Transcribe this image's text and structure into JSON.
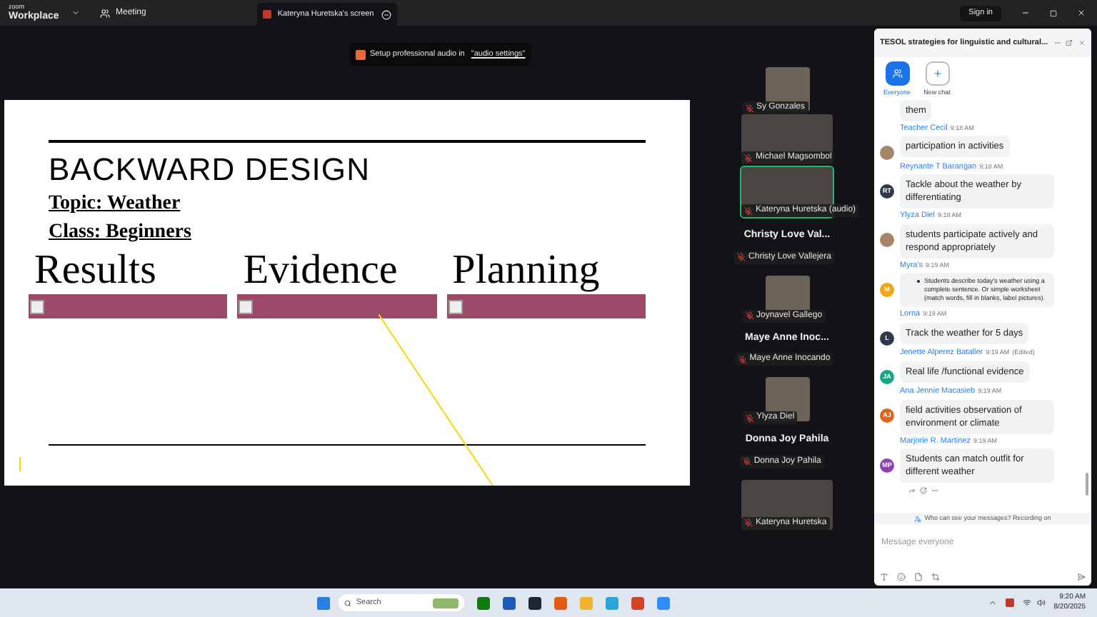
{
  "top_bar": {
    "brand_small": "zoom",
    "brand": "Workplace",
    "meeting_label": "Meeting",
    "screen_tab": "Kateryna Huretska's screen",
    "sign_in": "Sign in"
  },
  "notice": {
    "text": "Setup professional audio in ",
    "link": "\"audio settings\""
  },
  "slide": {
    "title": "BACKWARD DESIGN",
    "topic": "Topic: Weather",
    "class_line": "Class: Beginners",
    "columns": [
      "Results",
      "Evidence",
      "Planning"
    ]
  },
  "participants": [
    {
      "kind": "video_small",
      "name": "Sy Gonzales",
      "speaking": false
    },
    {
      "kind": "video_wide",
      "name": "Michael Magsombol",
      "speaking": false
    },
    {
      "kind": "video_wide",
      "name": "Kateryna Huretska (audio)",
      "speaking": true
    },
    {
      "kind": "name_tile",
      "heading": "Christy Love Val...",
      "name": "Christy Love Vallejera"
    },
    {
      "kind": "video_small",
      "name": "Joynavel Gallego",
      "speaking": false
    },
    {
      "kind": "name_tile",
      "heading": "Maye Anne Inoc...",
      "name": "Maye Anne Inocando"
    },
    {
      "kind": "video_small",
      "name": "Ylyza Diel",
      "speaking": false
    },
    {
      "kind": "name_tile",
      "heading": "Donna Joy Pahila",
      "name": "Donna Joy Pahila"
    },
    {
      "kind": "video_wide",
      "name": "Kateryna Huretska",
      "speaking": false
    }
  ],
  "chat": {
    "title": "TESOL strategies for linguistic and cultural...",
    "tabs": [
      {
        "label": "Everyone",
        "selected": true,
        "kind": "group"
      },
      {
        "label": "New chat",
        "selected": false,
        "kind": "new"
      }
    ],
    "messages": [
      {
        "kind": "text",
        "text": "them"
      },
      {
        "kind": "text",
        "sender": "Teacher Cecil",
        "time": "9:18 AM",
        "avatar": {
          "kind": "photo"
        },
        "text": "participation in activities"
      },
      {
        "kind": "text",
        "sender": "Reynante T Barangan",
        "time": "9:18 AM",
        "avatar": {
          "kind": "initials",
          "initials": "RT",
          "color": "#2f3b4c"
        },
        "text": "Tackle about the weather by differentiating"
      },
      {
        "kind": "text",
        "sender": "Ylyza Diel",
        "time": "9:18 AM",
        "avatar": {
          "kind": "photo"
        },
        "text": "students participate actively and respond appropriately"
      },
      {
        "kind": "bullet",
        "sender": "Myra's",
        "time": "9:19 AM",
        "avatar": {
          "kind": "initials",
          "initials": "M",
          "color": "#f2a516"
        },
        "text": "Students describe today's weather using a complete sentence. Or simple worksheet (match words, fill in blanks, label pictures)."
      },
      {
        "kind": "text",
        "sender": "Lorna",
        "time": "9:19 AM",
        "avatar": {
          "kind": "initials",
          "initials": "L",
          "color": "#2f3b4c"
        },
        "text": "Track the weather for 5 days"
      },
      {
        "kind": "text",
        "sender": "Jenette Alperez  Bataller",
        "time": "9:19 AM",
        "edited": "(Edited)",
        "avatar": {
          "kind": "initials",
          "initials": "JA",
          "color": "#17a589"
        },
        "text": "Real life /functional evidence"
      },
      {
        "kind": "text",
        "sender": "Ana Jennie Macasieb",
        "time": "9:19 AM",
        "avatar": {
          "kind": "initials",
          "initials": "AJ",
          "color": "#e0621b"
        },
        "text": "field activities observation of environment or climate"
      },
      {
        "kind": "text",
        "sender": "Marjorie R. Martinez",
        "time": "9:19 AM",
        "avatar": {
          "kind": "initials",
          "initials": "MP",
          "color": "#8e44ad"
        },
        "text": "Students can match outfit for different weather"
      }
    ],
    "privacy": "Who can see your messages? Recording on",
    "input": {
      "placeholder": "Message everyone"
    }
  },
  "taskbar": {
    "search": "Search",
    "time": "9:20 AM",
    "date": "8/20/2025"
  }
}
